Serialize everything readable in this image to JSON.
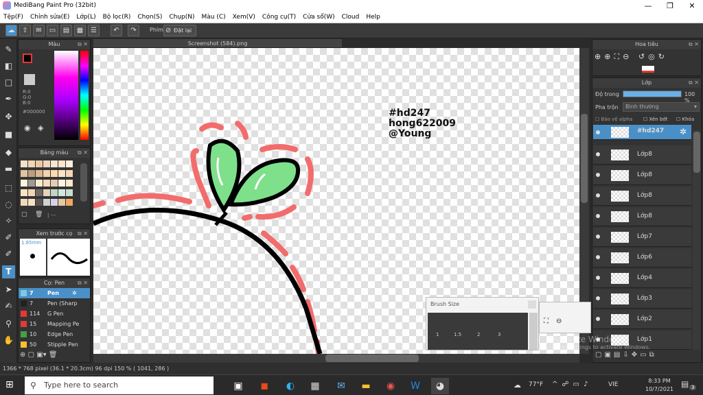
{
  "window": {
    "title": "MediBang Paint Pro (32bit)",
    "minimize": "—",
    "restore": "❐",
    "close": "✕"
  },
  "menu": [
    "Tệp(F)",
    "Chỉnh sửa(E)",
    "Lớp(L)",
    "Bộ lọc(R)",
    "Chọn(S)",
    "Chụp(N)",
    "Màu (C)",
    "Xem(V)",
    "Công cụ(T)",
    "Cửa sổ(W)",
    "Cloud",
    "Help"
  ],
  "toolbar": {
    "shortcut_label": "Phím",
    "reset_label": "Đặt lại"
  },
  "document": {
    "tab_title": "Screenshot (584).png"
  },
  "color_panel": {
    "title": "Màu",
    "r": "R:0",
    "g": "G:0",
    "b": "B:0",
    "hex": "#000000",
    "fg_color": "#000000",
    "bg_color": "#ffffff"
  },
  "palette_panel": {
    "title": "Bảng màu",
    "dash": "| ---"
  },
  "preview_panel": {
    "title": "Xem trước cọ",
    "size": "1.85mm"
  },
  "brush_panel": {
    "title": "Cọ: Pen",
    "brushes": [
      {
        "size": "7",
        "name": "Pen",
        "color": "#7ec8e3",
        "selected": true
      },
      {
        "size": "7",
        "name": "Pen (Sharp",
        "color": "#222222",
        "selected": false
      },
      {
        "size": "114",
        "name": "G Pen",
        "color": "#e53935",
        "selected": false
      },
      {
        "size": "15",
        "name": "Mapping Pe",
        "color": "#e53935",
        "selected": false
      },
      {
        "size": "10",
        "name": "Edge Pen",
        "color": "#43a047",
        "selected": false
      },
      {
        "size": "50",
        "name": "Stipple Pen",
        "color": "#fbc02d",
        "selected": false
      }
    ]
  },
  "navigator_panel": {
    "title": "Hoa tiêu"
  },
  "layer_panel": {
    "title": "Lớp",
    "opacity_label": "Độ trong",
    "opacity_value": "100 %",
    "opacity_fraction": 1.0,
    "blend_label": "Pha trộn",
    "blend_value": "Bình thường",
    "protect_alpha": "Bảo vệ alpha",
    "clipping": "Xén bớt",
    "lock": "Khóa",
    "layers": [
      {
        "name": "#hd247",
        "selected": true
      },
      {
        "name": "Lớp8",
        "selected": false
      },
      {
        "name": "Lớp8",
        "selected": false
      },
      {
        "name": "Lớp8",
        "selected": false
      },
      {
        "name": "Lớp8",
        "selected": false
      },
      {
        "name": "Lớp7",
        "selected": false
      },
      {
        "name": "Lớp6",
        "selected": false
      },
      {
        "name": "Lớp4",
        "selected": false
      },
      {
        "name": "Lớp3",
        "selected": false
      },
      {
        "name": "Lớp2",
        "selected": false
      },
      {
        "name": "Lớp1",
        "selected": false
      }
    ]
  },
  "canvas_text": {
    "line1": "#hd247",
    "line2": "hong622009",
    "line3": "@Young"
  },
  "brush_size_popup": {
    "title": "Brush Size",
    "labels": [
      "1",
      "1.5",
      "2",
      "3"
    ]
  },
  "watermark": {
    "line1": "Activate Windows",
    "line2": "Go to Settings to activate Windows."
  },
  "status": {
    "text": "1366 * 768 pixel   (36.1 * 20.3cm)   96 dpi   150 %   ( 1041, 286 )"
  },
  "taskbar": {
    "search_placeholder": "Type here to search",
    "weather": "77°F",
    "lang": "VIE",
    "time": "8:33 PM",
    "date": "10/7/2021",
    "notif_count": "3"
  },
  "colors": {
    "accent": "#4a90c8",
    "leaf": "#7ee08a",
    "pink": "#f26c6c"
  }
}
